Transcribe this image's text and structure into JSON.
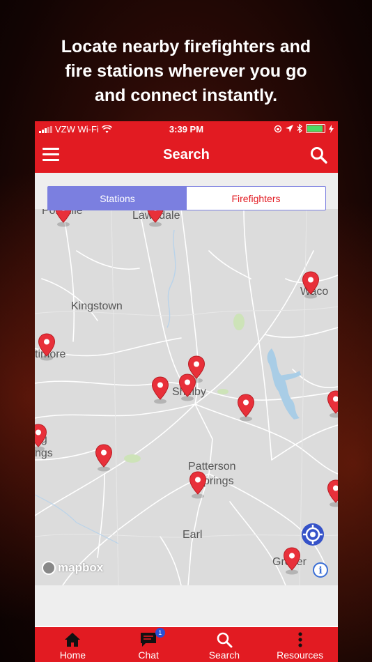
{
  "headline": "Locate nearby firefighters and\nfire stations wherever you go\nand  connect instantly.",
  "status_bar": {
    "carrier": "VZW Wi-Fi",
    "time": "3:39 PM"
  },
  "app_bar": {
    "title": "Search"
  },
  "segmented": {
    "stations_label": "Stations",
    "firefighters_label": "Firefighters",
    "selected": "Stations"
  },
  "map": {
    "labels": {
      "lawndale": "Lawndale",
      "polkville": "Polkville",
      "kingstown": "Kingstown",
      "waco": "Waco",
      "timore": "timore",
      "shelby": "Shelby",
      "ng": "ng",
      "ngs": "ngs",
      "patterson": "Patterson",
      "springs": "prings",
      "earl": "Earl",
      "grover": "Grover"
    },
    "attribution": "mapbox",
    "info": "i"
  },
  "tabs": {
    "home": "Home",
    "chat": "Chat",
    "chat_badge": "1",
    "search": "Search",
    "resources": "Resources"
  },
  "colors": {
    "brand_red": "#e21b22",
    "segment_active": "#7b7fe0",
    "pin": "#e8303a"
  }
}
